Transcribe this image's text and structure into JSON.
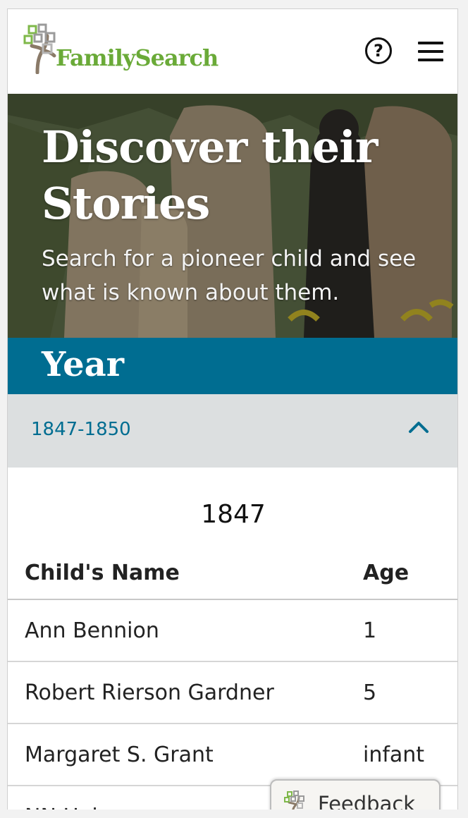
{
  "header": {
    "logo_text": "FamilySearch",
    "help_icon": "help-circle-icon",
    "help_symbol": "?",
    "menu_icon": "hamburger-menu-icon"
  },
  "hero": {
    "title": "Discover their Stories",
    "subtitle": "Search for a pioneer child and see what is known about them."
  },
  "year_section": {
    "title": "Year",
    "accordion_label": "1847-1850",
    "accordion_icon": "chevron-up-icon",
    "year_heading": "1847"
  },
  "table": {
    "headers": [
      "Child's Name",
      "Age"
    ],
    "rows": [
      {
        "name": "Ann Bennion",
        "age": "1"
      },
      {
        "name": "Robert Rierson Gardner",
        "age": "5"
      },
      {
        "name": "Margaret S. Grant",
        "age": "infant"
      },
      {
        "name": "NN Hale",
        "age": ""
      }
    ]
  },
  "feedback": {
    "label": "Feedback",
    "icon": "familysearch-tree-icon"
  },
  "colors": {
    "brand_green": "#6aaa38",
    "accent_blue": "#006d91",
    "accordion_bg": "#dcdfe0"
  }
}
